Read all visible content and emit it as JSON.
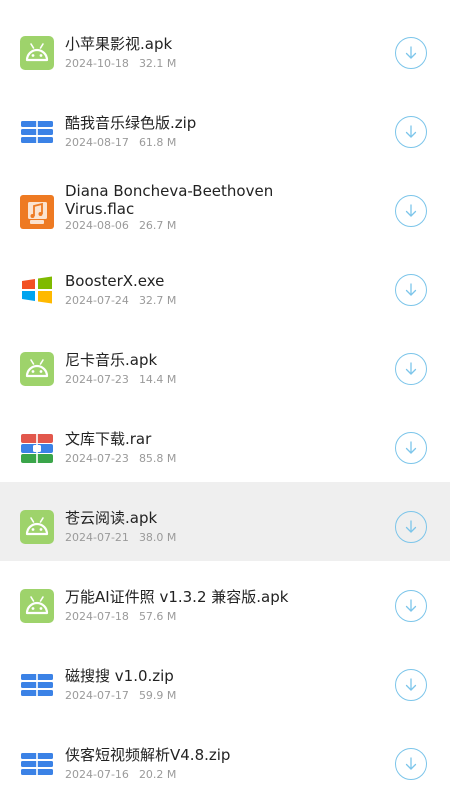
{
  "files": [
    {
      "name": "小苹果影视.apk",
      "date": "2024-10-18",
      "size": "32.1 M",
      "icon": "android-icon"
    },
    {
      "name": "酷我音乐绿色版.zip",
      "date": "2024-08-17",
      "size": "61.8 M",
      "icon": "archive-zip-icon"
    },
    {
      "name": "Diana Boncheva-Beethoven\nVirus.flac",
      "date": "2024-08-06",
      "size": "26.7 M",
      "icon": "audio-file-icon"
    },
    {
      "name": "BoosterX.exe",
      "date": "2024-07-24",
      "size": "32.7 M",
      "icon": "windows-exe-icon"
    },
    {
      "name": "尼卡音乐.apk",
      "date": "2024-07-23",
      "size": "14.4 M",
      "icon": "android-icon"
    },
    {
      "name": "文库下载.rar",
      "date": "2024-07-23",
      "size": "85.8 M",
      "icon": "archive-rar-icon"
    },
    {
      "name": "苍云阅读.apk",
      "date": "2024-07-21",
      "size": "38.0 M",
      "icon": "android-icon",
      "highlighted": true
    },
    {
      "name": "万能AI证件照 v1.3.2 兼容版.apk",
      "date": "2024-07-18",
      "size": "57.6 M",
      "icon": "android-icon"
    },
    {
      "name": "磁搜搜 v1.0.zip",
      "date": "2024-07-17",
      "size": "59.9 M",
      "icon": "archive-zip-icon"
    },
    {
      "name": "侠客短视频解析V4.8.zip",
      "date": "2024-07-16",
      "size": "20.2 M",
      "icon": "archive-zip-icon"
    }
  ],
  "colors": {
    "android": "#9ed36b",
    "zip": "#3b82e6",
    "audio": "#ee7a22",
    "download_ring": "#7cc5ea",
    "highlight_row": "#efefef",
    "meta_text": "#9a9a9a"
  }
}
